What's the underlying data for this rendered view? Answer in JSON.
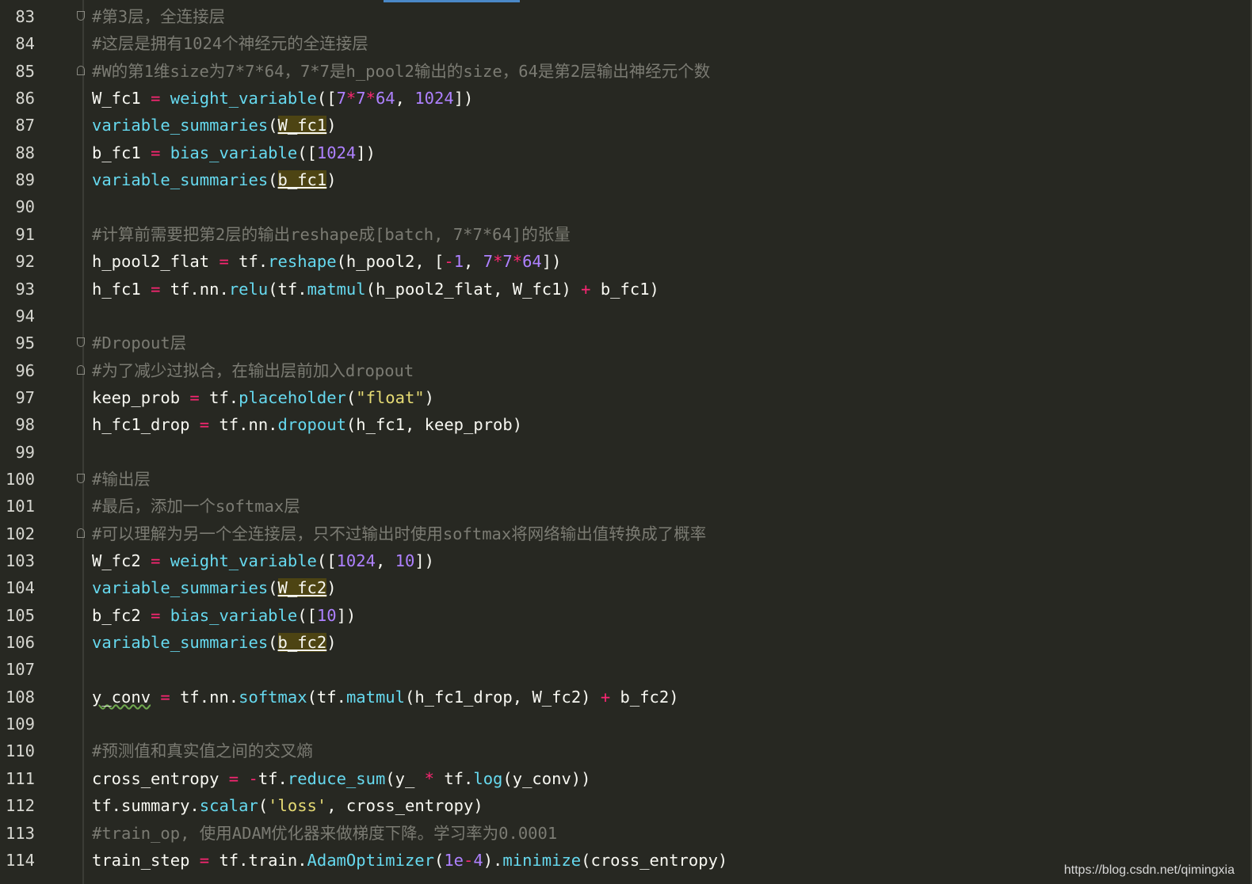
{
  "editor": {
    "lines": [
      {
        "n": "83",
        "fold": "start",
        "tokens": [
          {
            "t": "#第3层，全连接层",
            "c": "cm"
          }
        ]
      },
      {
        "n": "84",
        "fold": "",
        "tokens": [
          {
            "t": "#这层是拥有1024个神经元的全连接层",
            "c": "cm"
          }
        ]
      },
      {
        "n": "85",
        "fold": "end",
        "tokens": [
          {
            "t": "#W的第1维size为7*7*64，7*7是h_pool2输出的size，64是第2层输出神经元个数",
            "c": "cm"
          }
        ]
      },
      {
        "n": "86",
        "fold": "",
        "tokens": [
          {
            "t": "W_fc1 ",
            "c": ""
          },
          {
            "t": "=",
            "c": "op"
          },
          {
            "t": " ",
            "c": ""
          },
          {
            "t": "weight_variable",
            "c": "fn"
          },
          {
            "t": "([",
            "c": ""
          },
          {
            "t": "7",
            "c": "nm"
          },
          {
            "t": "*",
            "c": "op"
          },
          {
            "t": "7",
            "c": "nm"
          },
          {
            "t": "*",
            "c": "op"
          },
          {
            "t": "64",
            "c": "nm"
          },
          {
            "t": ", ",
            "c": ""
          },
          {
            "t": "1024",
            "c": "nm"
          },
          {
            "t": "])",
            "c": ""
          }
        ]
      },
      {
        "n": "87",
        "fold": "",
        "tokens": [
          {
            "t": "variable_summaries",
            "c": "fn"
          },
          {
            "t": "(",
            "c": ""
          },
          {
            "t": "W_fc1",
            "c": "hl"
          },
          {
            "t": ")",
            "c": ""
          }
        ]
      },
      {
        "n": "88",
        "fold": "",
        "tokens": [
          {
            "t": "b_fc1 ",
            "c": ""
          },
          {
            "t": "=",
            "c": "op"
          },
          {
            "t": " ",
            "c": ""
          },
          {
            "t": "bias_variable",
            "c": "fn"
          },
          {
            "t": "([",
            "c": ""
          },
          {
            "t": "1024",
            "c": "nm"
          },
          {
            "t": "])",
            "c": ""
          }
        ]
      },
      {
        "n": "89",
        "fold": "",
        "tokens": [
          {
            "t": "variable_summaries",
            "c": "fn"
          },
          {
            "t": "(",
            "c": ""
          },
          {
            "t": "b_fc1",
            "c": "hl"
          },
          {
            "t": ")",
            "c": ""
          }
        ]
      },
      {
        "n": "90",
        "fold": "",
        "tokens": []
      },
      {
        "n": "91",
        "fold": "",
        "tokens": [
          {
            "t": "#计算前需要把第2层的输出reshape成[batch, 7*7*64]的张量",
            "c": "cm"
          }
        ]
      },
      {
        "n": "92",
        "fold": "",
        "tokens": [
          {
            "t": "h_pool2_flat ",
            "c": ""
          },
          {
            "t": "=",
            "c": "op"
          },
          {
            "t": " tf.",
            "c": ""
          },
          {
            "t": "reshape",
            "c": "fn"
          },
          {
            "t": "(h_pool2, [",
            "c": ""
          },
          {
            "t": "-",
            "c": "op"
          },
          {
            "t": "1",
            "c": "nm"
          },
          {
            "t": ", ",
            "c": ""
          },
          {
            "t": "7",
            "c": "nm"
          },
          {
            "t": "*",
            "c": "op"
          },
          {
            "t": "7",
            "c": "nm"
          },
          {
            "t": "*",
            "c": "op"
          },
          {
            "t": "64",
            "c": "nm"
          },
          {
            "t": "])",
            "c": ""
          }
        ]
      },
      {
        "n": "93",
        "fold": "",
        "tokens": [
          {
            "t": "h_fc1 ",
            "c": ""
          },
          {
            "t": "=",
            "c": "op"
          },
          {
            "t": " tf.nn.",
            "c": ""
          },
          {
            "t": "relu",
            "c": "fn"
          },
          {
            "t": "(tf.",
            "c": ""
          },
          {
            "t": "matmul",
            "c": "fn"
          },
          {
            "t": "(h_pool2_flat, W_fc1) ",
            "c": ""
          },
          {
            "t": "+",
            "c": "op"
          },
          {
            "t": " b_fc1)",
            "c": ""
          }
        ]
      },
      {
        "n": "94",
        "fold": "",
        "tokens": []
      },
      {
        "n": "95",
        "fold": "start",
        "tokens": [
          {
            "t": "#Dropout层",
            "c": "cm"
          }
        ]
      },
      {
        "n": "96",
        "fold": "end",
        "tokens": [
          {
            "t": "#为了减少过拟合，在输出层前加入dropout",
            "c": "cm"
          }
        ]
      },
      {
        "n": "97",
        "fold": "",
        "tokens": [
          {
            "t": "keep_prob ",
            "c": ""
          },
          {
            "t": "=",
            "c": "op"
          },
          {
            "t": " tf.",
            "c": ""
          },
          {
            "t": "placeholder",
            "c": "fn"
          },
          {
            "t": "(",
            "c": ""
          },
          {
            "t": "\"float\"",
            "c": "st"
          },
          {
            "t": ")",
            "c": ""
          }
        ]
      },
      {
        "n": "98",
        "fold": "",
        "tokens": [
          {
            "t": "h_fc1_drop ",
            "c": ""
          },
          {
            "t": "=",
            "c": "op"
          },
          {
            "t": " tf.nn.",
            "c": ""
          },
          {
            "t": "dropout",
            "c": "fn"
          },
          {
            "t": "(h_fc1, keep_prob)",
            "c": ""
          }
        ]
      },
      {
        "n": "99",
        "fold": "",
        "tokens": []
      },
      {
        "n": "100",
        "fold": "start",
        "tokens": [
          {
            "t": "#输出层",
            "c": "cm"
          }
        ]
      },
      {
        "n": "101",
        "fold": "",
        "tokens": [
          {
            "t": "#最后，添加一个softmax层",
            "c": "cm"
          }
        ]
      },
      {
        "n": "102",
        "fold": "end",
        "tokens": [
          {
            "t": "#可以理解为另一个全连接层，只不过输出时使用softmax将网络输出值转换成了概率",
            "c": "cm"
          }
        ]
      },
      {
        "n": "103",
        "fold": "",
        "tokens": [
          {
            "t": "W_fc2 ",
            "c": ""
          },
          {
            "t": "=",
            "c": "op"
          },
          {
            "t": " ",
            "c": ""
          },
          {
            "t": "weight_variable",
            "c": "fn"
          },
          {
            "t": "([",
            "c": ""
          },
          {
            "t": "1024",
            "c": "nm"
          },
          {
            "t": ", ",
            "c": ""
          },
          {
            "t": "10",
            "c": "nm"
          },
          {
            "t": "])",
            "c": ""
          }
        ]
      },
      {
        "n": "104",
        "fold": "",
        "tokens": [
          {
            "t": "variable_summaries",
            "c": "fn"
          },
          {
            "t": "(",
            "c": ""
          },
          {
            "t": "W_fc2",
            "c": "hl"
          },
          {
            "t": ")",
            "c": ""
          }
        ]
      },
      {
        "n": "105",
        "fold": "",
        "tokens": [
          {
            "t": "b_fc2 ",
            "c": ""
          },
          {
            "t": "=",
            "c": "op"
          },
          {
            "t": " ",
            "c": ""
          },
          {
            "t": "bias_variable",
            "c": "fn"
          },
          {
            "t": "([",
            "c": ""
          },
          {
            "t": "10",
            "c": "nm"
          },
          {
            "t": "])",
            "c": ""
          }
        ]
      },
      {
        "n": "106",
        "fold": "",
        "tokens": [
          {
            "t": "variable_summaries",
            "c": "fn"
          },
          {
            "t": "(",
            "c": ""
          },
          {
            "t": "b_fc2",
            "c": "hl"
          },
          {
            "t": ")",
            "c": ""
          }
        ]
      },
      {
        "n": "107",
        "fold": "",
        "tokens": []
      },
      {
        "n": "108",
        "fold": "",
        "tokens": [
          {
            "t": "y_conv",
            "c": "wv"
          },
          {
            "t": " ",
            "c": ""
          },
          {
            "t": "=",
            "c": "op"
          },
          {
            "t": " tf.nn.",
            "c": ""
          },
          {
            "t": "softmax",
            "c": "fn"
          },
          {
            "t": "(tf.",
            "c": ""
          },
          {
            "t": "matmul",
            "c": "fn"
          },
          {
            "t": "(h_fc1_drop, W_fc2) ",
            "c": ""
          },
          {
            "t": "+",
            "c": "op"
          },
          {
            "t": " b_fc2)",
            "c": ""
          }
        ]
      },
      {
        "n": "109",
        "fold": "",
        "tokens": []
      },
      {
        "n": "110",
        "fold": "",
        "tokens": [
          {
            "t": "#预测值和真实值之间的交叉熵",
            "c": "cm"
          }
        ]
      },
      {
        "n": "111",
        "fold": "",
        "tokens": [
          {
            "t": "cross_entropy ",
            "c": ""
          },
          {
            "t": "=",
            "c": "op"
          },
          {
            "t": " ",
            "c": ""
          },
          {
            "t": "-",
            "c": "op"
          },
          {
            "t": "tf.",
            "c": ""
          },
          {
            "t": "reduce_sum",
            "c": "fn"
          },
          {
            "t": "(y_ ",
            "c": ""
          },
          {
            "t": "*",
            "c": "op"
          },
          {
            "t": " tf.",
            "c": ""
          },
          {
            "t": "log",
            "c": "fn"
          },
          {
            "t": "(y_conv))",
            "c": ""
          }
        ]
      },
      {
        "n": "112",
        "fold": "",
        "tokens": [
          {
            "t": "tf.summary.",
            "c": ""
          },
          {
            "t": "scalar",
            "c": "fn"
          },
          {
            "t": "(",
            "c": ""
          },
          {
            "t": "'loss'",
            "c": "st"
          },
          {
            "t": ", cross_entropy)",
            "c": ""
          }
        ]
      },
      {
        "n": "113",
        "fold": "",
        "tokens": [
          {
            "t": "#train_op, 使用ADAM优化器来做梯度下降。学习率为0.0001",
            "c": "cm"
          }
        ]
      },
      {
        "n": "114",
        "fold": "",
        "tokens": [
          {
            "t": "train_step ",
            "c": ""
          },
          {
            "t": "=",
            "c": "op"
          },
          {
            "t": " tf.train.",
            "c": ""
          },
          {
            "t": "AdamOptimizer",
            "c": "fn"
          },
          {
            "t": "(",
            "c": ""
          },
          {
            "t": "1e",
            "c": "nm"
          },
          {
            "t": "-",
            "c": "op"
          },
          {
            "t": "4",
            "c": "nm"
          },
          {
            "t": ").",
            "c": ""
          },
          {
            "t": "minimize",
            "c": "fn"
          },
          {
            "t": "(cross_entropy)",
            "c": ""
          }
        ]
      }
    ]
  },
  "watermark": "https://blog.csdn.net/qimingxia",
  "colors": {
    "background": "#272822",
    "comment": "#7b7b73",
    "function": "#66d9ef",
    "number": "#ae81ff",
    "operator": "#f92672",
    "string": "#e6db74"
  }
}
